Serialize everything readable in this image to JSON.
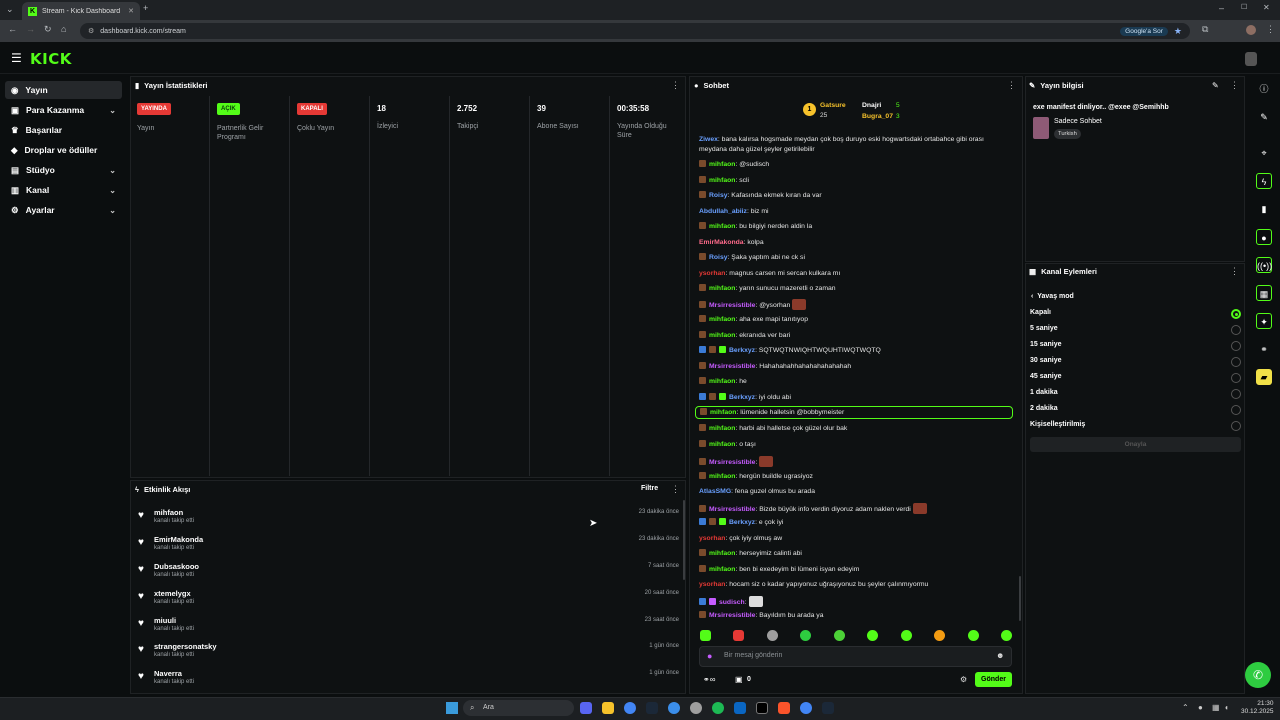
{
  "browser": {
    "tab_title": "Stream - Kick Dashboard",
    "url": "dashboard.kick.com/stream",
    "google_sor": "Google'a Sor"
  },
  "brand": {
    "logo": "KICK",
    "accent": "#53fc18"
  },
  "sidebar": {
    "items": [
      {
        "label": "Yayın",
        "icon": "broadcast-icon"
      },
      {
        "label": "Para Kazanma",
        "icon": "money-icon"
      },
      {
        "label": "Başarılar",
        "icon": "trophy-icon"
      },
      {
        "label": "Droplar ve ödüller",
        "icon": "gift-icon"
      },
      {
        "label": "Stüdyo",
        "icon": "studio-icon"
      },
      {
        "label": "Kanal",
        "icon": "channel-icon"
      },
      {
        "label": "Ayarlar",
        "icon": "gear-icon"
      }
    ]
  },
  "stats": {
    "title": "Yayın İstatistikleri",
    "cols": [
      {
        "badge": "YAYINDA",
        "label": "Yayın"
      },
      {
        "badge": "AÇIK",
        "label": "Partnerlik Gelir Programı"
      },
      {
        "badge": "KAPALI",
        "label": "Çoklu Yayın"
      },
      {
        "value": "18",
        "label": "İzleyici"
      },
      {
        "value": "2.752",
        "label": "Takipçi"
      },
      {
        "value": "39",
        "label": "Abone Sayısı"
      },
      {
        "value": "00:35:58",
        "label": "Yayında Olduğu Süre"
      }
    ]
  },
  "activity": {
    "title": "Etkinlik Akışı",
    "filter": "Filtre",
    "rows": [
      {
        "name": "mihfaon",
        "sub": "kanalı takip etti",
        "time": "23 dakika önce"
      },
      {
        "name": "EmirMakonda",
        "sub": "kanalı takip etti",
        "time": "23 dakika önce"
      },
      {
        "name": "Dubsaskooo",
        "sub": "kanalı takip etti",
        "time": "7 saat önce"
      },
      {
        "name": "xtemelygx",
        "sub": "kanalı takip etti",
        "time": "20 saat önce"
      },
      {
        "name": "miuuli",
        "sub": "kanalı takip etti",
        "time": "23 saat önce"
      },
      {
        "name": "strangersonatsky",
        "sub": "kanalı takip etti",
        "time": "1 gün önce"
      },
      {
        "name": "Naverra",
        "sub": "kanalı takip etti",
        "time": "1 gün önce"
      }
    ]
  },
  "chat": {
    "title": "Sohbet",
    "leaders": [
      {
        "name": "Gatsure",
        "count": "25"
      },
      {
        "name": "Dnajri",
        "count": "5"
      },
      {
        "name": "Bugra_07",
        "count": "3"
      }
    ],
    "messages": [
      {
        "user": "Ziwex",
        "color": "#6aa0ff",
        "text": ": bana kalırsa hogsmade meydan çok boş duruyo eski hogwartsdaki ortabahce gibi orası",
        "cont": "meydana daha güzel şeyler getirilebilir"
      },
      {
        "user": "mihfaon",
        "color": "#53fc18",
        "text": ": @sudisch"
      },
      {
        "user": "mihfaon",
        "color": "#53fc18",
        "text": ": scli"
      },
      {
        "user": "Roisy",
        "color": "#6aa0ff",
        "text": ": Kafasında ekmek kıran da var"
      },
      {
        "user": "Abdullah_abiiz",
        "color": "#6aa0ff",
        "text": ": biz mi"
      },
      {
        "user": "mihfaon",
        "color": "#53fc18",
        "text": ": bu bilgiyi nerden aldin la"
      },
      {
        "user": "EmirMakonda",
        "color": "#ff6b8b",
        "text": ": kolpa"
      },
      {
        "user": "Roisy",
        "color": "#6aa0ff",
        "text": ": Şaka yaptım abi ne ck si"
      },
      {
        "user": "ysorhan",
        "color": "#e53935",
        "text": ": magnus carsen mi sercan kulkara mı"
      },
      {
        "user": "mihfaon",
        "color": "#53fc18",
        "text": ": yarın sunucu mazeretli o zaman"
      },
      {
        "user": "Mrsirresistible",
        "color": "#c65cff",
        "text": ": @ysorhan"
      },
      {
        "user": "mihfaon",
        "color": "#53fc18",
        "text": ": aha exe mapi tanıtıyop"
      },
      {
        "user": "mihfaon",
        "color": "#53fc18",
        "text": ": ekranıda ver bari"
      },
      {
        "user": "Berkxyz",
        "color": "#6aa0ff",
        "text": ": SQTWQTNWIQHTWQUHTIWQTWQTQ"
      },
      {
        "user": "Mrsirresistible",
        "color": "#c65cff",
        "text": ": Hahahahahhahahahahahahah"
      },
      {
        "user": "mihfaon",
        "color": "#53fc18",
        "text": ": he"
      },
      {
        "user": "Berkxyz",
        "color": "#6aa0ff",
        "text": ": iyi oldu abi"
      },
      {
        "user": "mihfaon",
        "color": "#53fc18",
        "text": ": lümenide halletsin @bobbymeister"
      },
      {
        "user": "mihfaon",
        "color": "#53fc18",
        "text": ": harbi abi halletse çok güzel olur bak"
      },
      {
        "user": "mihfaon",
        "color": "#53fc18",
        "text": ": o taşı"
      },
      {
        "user": "Mrsirresistible",
        "color": "#c65cff",
        "text": ":"
      },
      {
        "user": "mihfaon",
        "color": "#53fc18",
        "text": ": hergün buildle ugrasiyoz"
      },
      {
        "user": "AtlasSMG",
        "color": "#6aa0ff",
        "text": ": fena guzel olmus bu arada"
      },
      {
        "user": "Mrsirresistible",
        "color": "#c65cff",
        "text": ": Bizde büyük info verdin diyoruz adam naklen verdi"
      },
      {
        "user": "Berkxyz",
        "color": "#6aa0ff",
        "text": ": e çok iyi"
      },
      {
        "user": "ysorhan",
        "color": "#e53935",
        "text": ": çok iyiy olmuş aw"
      },
      {
        "user": "mihfaon",
        "color": "#53fc18",
        "text": ": herseyimiz calinti abi"
      },
      {
        "user": "mihfaon",
        "color": "#53fc18",
        "text": ": ben bi exedeyim bi lümeni isyan edeyim"
      },
      {
        "user": "ysorhan",
        "color": "#e53935",
        "text": ": hocam siz o kadar yapıyonuz uğraşıyonuz bu şeyler çalınmıyormu"
      },
      {
        "user": "sudisch",
        "color": "#c65cff",
        "text": ":"
      },
      {
        "user": "Mrsirresistible",
        "color": "#c65cff",
        "text": ": Bayıldım bu arada ya"
      }
    ],
    "input_placeholder": "Bir mesaj gönderin",
    "send": "Gönder",
    "viewer_count": "0"
  },
  "stream_info": {
    "title": "Yayın bilgisi",
    "stream_title": "exe manifest dinliyor.. @exee @Semihhb",
    "category": "Sadece Sohbet",
    "tag": "Turkish"
  },
  "channel_actions": {
    "title": "Kanal Eylemleri",
    "back": "Yavaş mod",
    "options": [
      "Kapalı",
      "5 saniye",
      "15 saniye",
      "30 saniye",
      "45 saniye",
      "1 dakika",
      "2 dakika",
      "Kişiselleştirilmiş"
    ],
    "confirm": "Onayla"
  },
  "taskbar": {
    "search": "Ara",
    "time": "21:30",
    "date": "30.12.2025"
  }
}
